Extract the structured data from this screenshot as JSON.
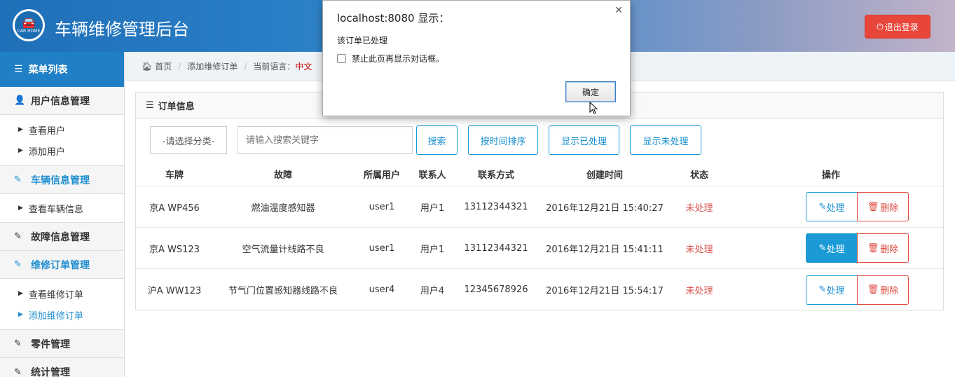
{
  "header": {
    "logo_text": "CAR HOME",
    "title": "车辆维修管理后台",
    "logout_label": "退出登录"
  },
  "sidebar": {
    "title": "菜单列表",
    "groups": [
      {
        "label": "用户信息管理",
        "items": [
          "查看用户",
          "添加用户"
        ]
      },
      {
        "label": "车辆信息管理",
        "items": [
          "查看车辆信息"
        ]
      },
      {
        "label": "故障信息管理",
        "items": []
      },
      {
        "label": "维修订单管理",
        "items": [
          "查看维修订单",
          "添加维修订单"
        ]
      },
      {
        "label": "零件管理",
        "items": []
      },
      {
        "label": "统计管理",
        "items": []
      }
    ]
  },
  "breadcrumb": {
    "home": "首页",
    "page": "添加维修订单",
    "lang_label": "当前语言：",
    "lang_value": "中文"
  },
  "panel": {
    "title": "订单信息",
    "select_value": "-请选择分类-",
    "search_placeholder": "请输入搜索关键字",
    "buttons": {
      "search": "搜索",
      "sort_time": "按时间排序",
      "show_done": "显示已处理",
      "show_pending": "显示未处理"
    }
  },
  "table": {
    "headers": [
      "车牌",
      "故障",
      "所属用户",
      "联系人",
      "联系方式",
      "创建时间",
      "状态",
      "操作"
    ],
    "rows": [
      {
        "plate": "京A WP456",
        "fault": "燃油温度感知器",
        "user": "user1",
        "contact": "用户1",
        "phone": "13112344321",
        "created": "2016年12月21日 15:40:27",
        "status": "未处理"
      },
      {
        "plate": "京A WS123",
        "fault": "空气流量计线路不良",
        "user": "user1",
        "contact": "用户1",
        "phone": "13112344321",
        "created": "2016年12月21日 15:41:11",
        "status": "未处理"
      },
      {
        "plate": "沪A WW123",
        "fault": "节气门位置感知器线路不良",
        "user": "user4",
        "contact": "用户4",
        "phone": "12345678926",
        "created": "2016年12月21日 15:54:17",
        "status": "未处理"
      }
    ],
    "handle_label": "处理",
    "delete_label": "删除"
  },
  "dialog": {
    "title": "localhost:8080 显示：",
    "message": "该订单已处理",
    "checkbox_label": "禁止此页再显示对话框。",
    "ok_label": "确定"
  },
  "colors": {
    "accent": "#1a9bd6",
    "danger": "#e04a3f",
    "sidebar_header": "#1f7fc7"
  }
}
